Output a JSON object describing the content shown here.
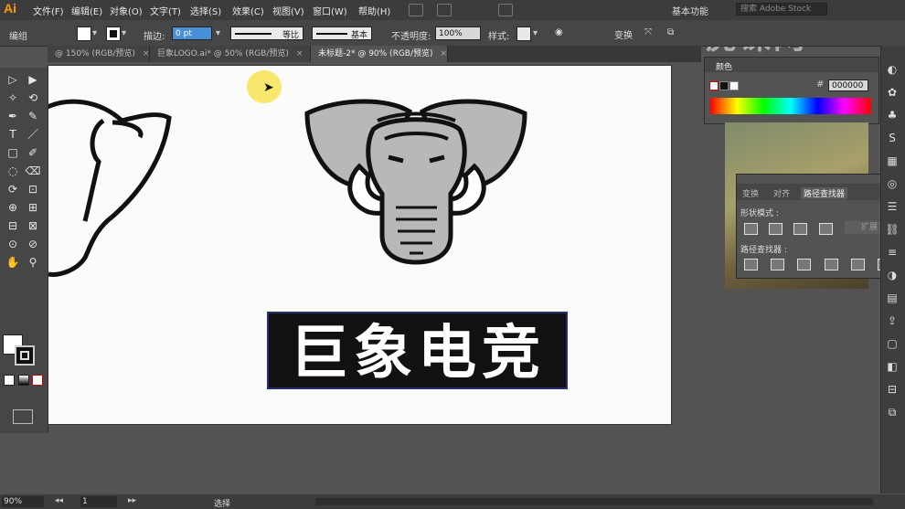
{
  "app": {
    "logo": "Ai"
  },
  "menus": [
    "文件(F)",
    "编辑(E)",
    "对象(O)",
    "文字(T)",
    "选择(S)",
    "效果(C)",
    "视图(V)",
    "窗口(W)",
    "帮助(H)"
  ],
  "workspace": "基本功能",
  "search_placeholder": "搜索 Adobe Stock",
  "watermark": "虎课网",
  "control": {
    "group_label": "编组",
    "stroke_label": "描边:",
    "stroke_value": "0 pt",
    "profile_label": "等比",
    "brush_label": "基本",
    "opacity_label": "不透明度:",
    "opacity_value": "100%",
    "style_label": "样式:",
    "transform_label": "变换"
  },
  "tabs": [
    {
      "label": "@ 150% (RGB/预览)",
      "active": false
    },
    {
      "label": "巨象LOGO.ai* @ 50% (RGB/预览)",
      "active": false
    },
    {
      "label": "未标题-2* @ 90% (RGB/预览)",
      "active": true
    }
  ],
  "tools": [
    "▷",
    "▶",
    "✧",
    "⟲",
    "✒",
    "✎",
    "T",
    "／",
    "□",
    "✐",
    "◌",
    "⌫",
    "⟳",
    "⊡",
    "⊕",
    "⊞",
    "⊟",
    "⊠",
    "⊙",
    "⊘",
    "✋",
    "⚲"
  ],
  "artwork": {
    "title_text": "巨象电竞",
    "colors": {
      "gray": "#b8b8b8",
      "black": "#111111",
      "white": "#ffffff",
      "title_shadow": "#2a2d6e"
    }
  },
  "color_panel": {
    "tab": "颜色",
    "hex": "000000"
  },
  "pathfinder": {
    "tabs": [
      "变换",
      "对齐",
      "路径查找器"
    ],
    "shape_modes_label": "形状模式 :",
    "expand_button": "扩展",
    "pathfinders_label": "路径查找器 :"
  },
  "status": {
    "zoom": "90%",
    "page": "1",
    "tool": "选择"
  }
}
